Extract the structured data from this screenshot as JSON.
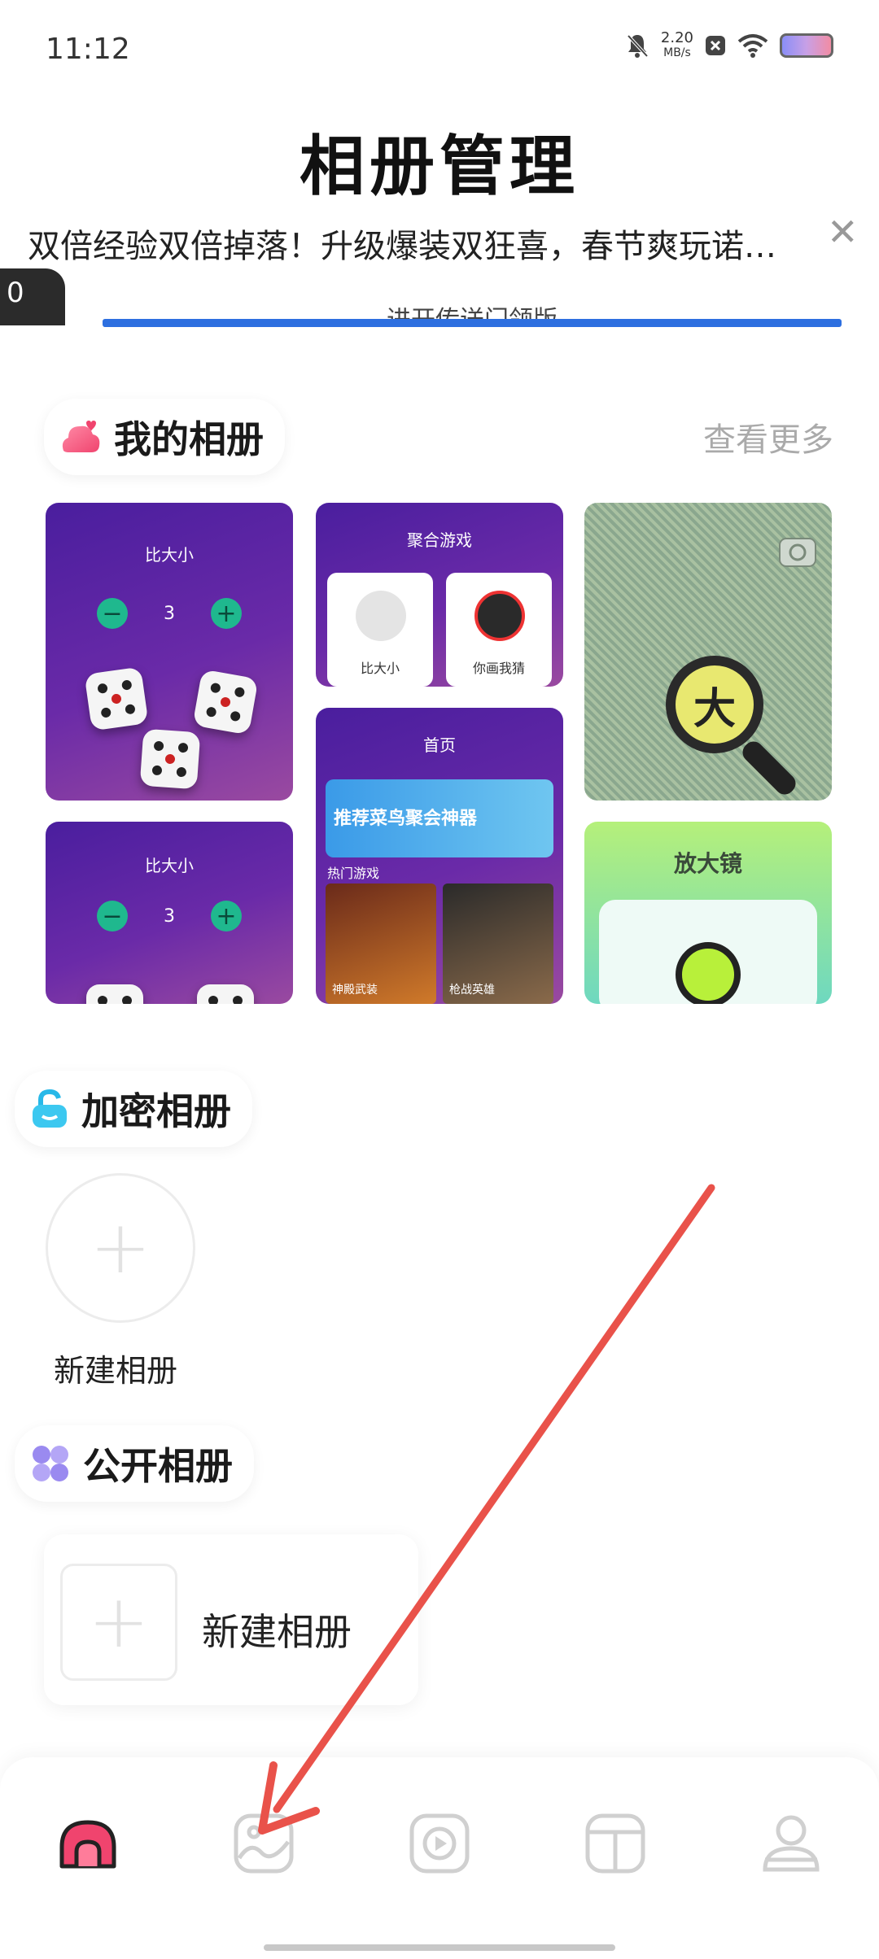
{
  "status_bar": {
    "time": "11:12",
    "net_speed_value": "2.20",
    "net_speed_unit": "MB/s"
  },
  "page_title": "相册管理",
  "ad": {
    "text": "双倍经验双倍掉落！升级爆装双狂喜，春节爽玩诺…",
    "thumb_label": "0",
    "bar_text": "进开传送门领版"
  },
  "my_albums": {
    "title": "我的相册",
    "view_more": "查看更多",
    "thumbs": [
      {
        "title": "比大小",
        "value": "3"
      },
      {
        "title": "聚合游戏",
        "games": [
          "比大小",
          "你画我猜"
        ]
      },
      {
        "title": "",
        "magnifier_char": "大"
      },
      {
        "title": "比大小",
        "value": "3"
      },
      {
        "title": "首页",
        "banner": "推荐菜鸟聚会神器",
        "section": "热门游戏",
        "games": [
          "神殿武装",
          "枪战英雄"
        ]
      },
      {
        "title": "放大镜"
      }
    ]
  },
  "encrypted_albums": {
    "title": "加密相册",
    "new_label": "新建相册"
  },
  "public_albums": {
    "title": "公开相册",
    "new_label": "新建相册"
  },
  "tabbar": {
    "items": [
      {
        "icon": "home-icon",
        "active": true
      },
      {
        "icon": "gallery-icon",
        "active": false
      },
      {
        "icon": "video-play-icon",
        "active": false
      },
      {
        "icon": "text-tool-icon",
        "active": false
      },
      {
        "icon": "profile-icon",
        "active": false
      }
    ]
  },
  "colors": {
    "accent_pink": "#f0446e",
    "annotation_arrow": "#e9524a",
    "ad_bar": "#2d6fe0"
  }
}
